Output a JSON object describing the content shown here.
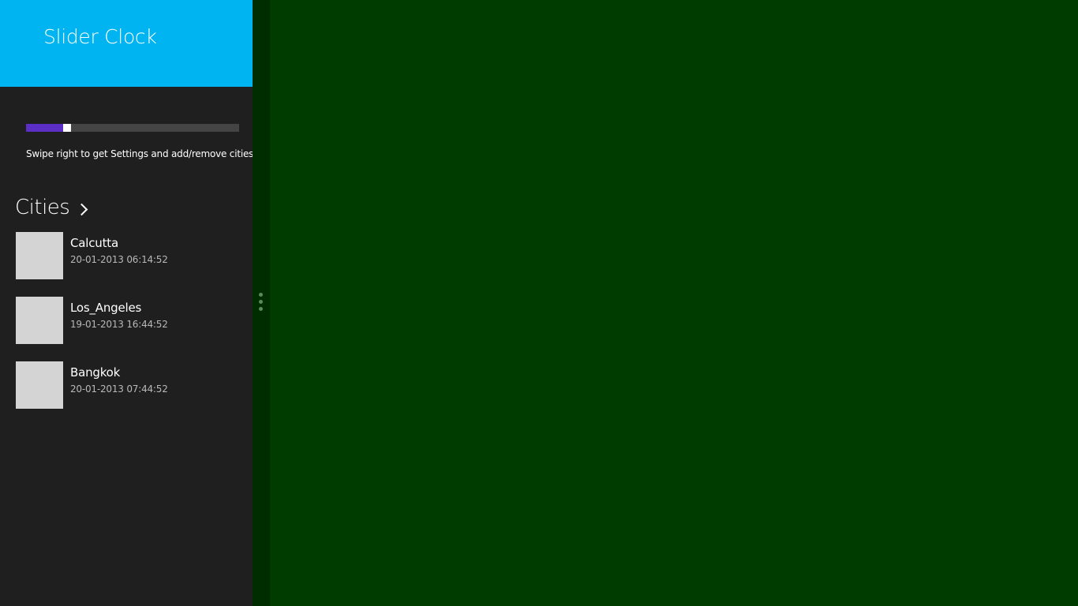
{
  "app": {
    "title": "Slider Clock",
    "header_color": "#00b4f1",
    "pane_color": "#1f1f1f",
    "background_color": "#003b00"
  },
  "slider": {
    "value_fraction": 0.18,
    "fill_color": "#5b2fc6"
  },
  "hint_text": "Swipe right to get Settings and add/remove cities.",
  "cities": {
    "title": "Cities",
    "chevron_icon": "chevron-right-icon",
    "items": [
      {
        "name": "Calcutta",
        "time": "20-01-2013 06:14:52"
      },
      {
        "name": "Los_Angeles",
        "time": "19-01-2013 16:44:52"
      },
      {
        "name": "Bangkok",
        "time": "20-01-2013 07:44:52"
      }
    ]
  },
  "splitter": {
    "grip_icon": "vertical-grip-icon"
  }
}
